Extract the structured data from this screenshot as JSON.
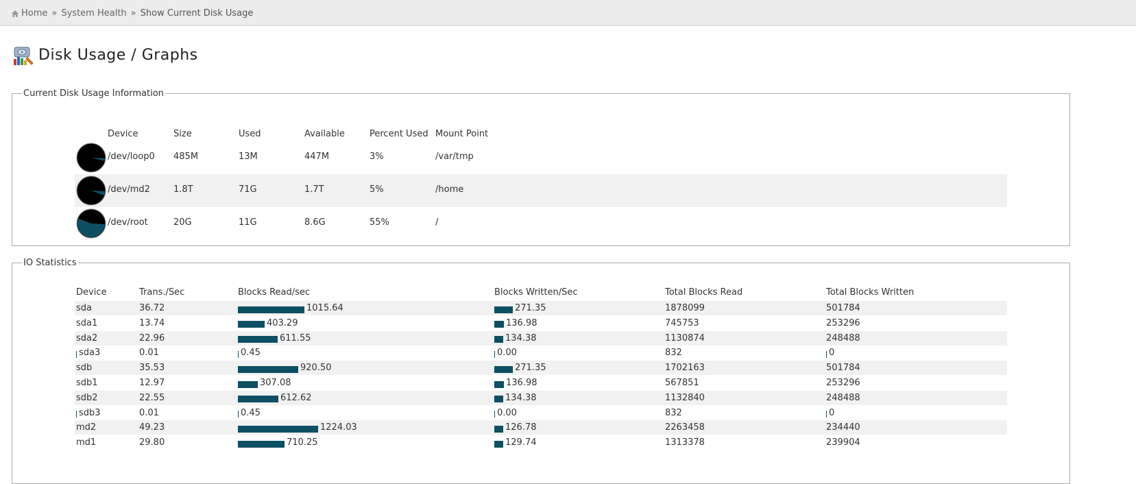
{
  "breadcrumb": {
    "items": [
      "Home",
      "System Health",
      "Show Current Disk Usage"
    ],
    "separator": "»"
  },
  "page_title": "Disk Usage / Graphs",
  "disk_usage": {
    "legend": "Current Disk Usage Information",
    "headers": [
      "Device",
      "Size",
      "Used",
      "Available",
      "Percent Used",
      "Mount Point"
    ],
    "rows": [
      {
        "device": "/dev/loop0",
        "size": "485M",
        "used": "13M",
        "available": "447M",
        "percent": "3%",
        "mount": "/var/tmp",
        "fraction": 0.03
      },
      {
        "device": "/dev/md2",
        "size": "1.8T",
        "used": "71G",
        "available": "1.7T",
        "percent": "5%",
        "mount": "/home",
        "fraction": 0.05
      },
      {
        "device": "/dev/root",
        "size": "20G",
        "used": "11G",
        "available": "8.6G",
        "percent": "55%",
        "mount": "/",
        "fraction": 0.55
      }
    ]
  },
  "io_stats": {
    "legend": "IO Statistics",
    "headers": [
      "Device",
      "Trans./Sec",
      "Blocks Read/sec",
      "Blocks Written/Sec",
      "Total Blocks Read",
      "Total Blocks Written"
    ],
    "rows": [
      {
        "device": "sda",
        "tps": "36.72",
        "read": "1015.64",
        "written": "271.35",
        "total_read": "1878099",
        "total_written": "501784"
      },
      {
        "device": "sda1",
        "tps": "13.74",
        "read": "403.29",
        "written": "136.98",
        "total_read": "745753",
        "total_written": "253296"
      },
      {
        "device": "sda2",
        "tps": "22.96",
        "read": "611.55",
        "written": "134.38",
        "total_read": "1130874",
        "total_written": "248488"
      },
      {
        "device": "sda3",
        "tps": "0.01",
        "read": "0.45",
        "written": "0.00",
        "total_read": "832",
        "total_written": "0"
      },
      {
        "device": "sdb",
        "tps": "35.53",
        "read": "920.50",
        "written": "271.35",
        "total_read": "1702163",
        "total_written": "501784"
      },
      {
        "device": "sdb1",
        "tps": "12.97",
        "read": "307.08",
        "written": "136.98",
        "total_read": "567851",
        "total_written": "253296"
      },
      {
        "device": "sdb2",
        "tps": "22.55",
        "read": "612.62",
        "written": "134.38",
        "total_read": "1132840",
        "total_written": "248488"
      },
      {
        "device": "sdb3",
        "tps": "0.01",
        "read": "0.45",
        "written": "0.00",
        "total_read": "832",
        "total_written": "0"
      },
      {
        "device": "md2",
        "tps": "49.23",
        "read": "1224.03",
        "written": "126.78",
        "total_read": "2263458",
        "total_written": "234440"
      },
      {
        "device": "md1",
        "tps": "29.80",
        "read": "710.25",
        "written": "129.74",
        "total_read": "1313378",
        "total_written": "239904"
      }
    ]
  },
  "colors": {
    "accent": "#0d4f63",
    "pie_bg": "#000000",
    "pie_fill": "#0d4f63",
    "stripe": "#f1f1f1"
  }
}
